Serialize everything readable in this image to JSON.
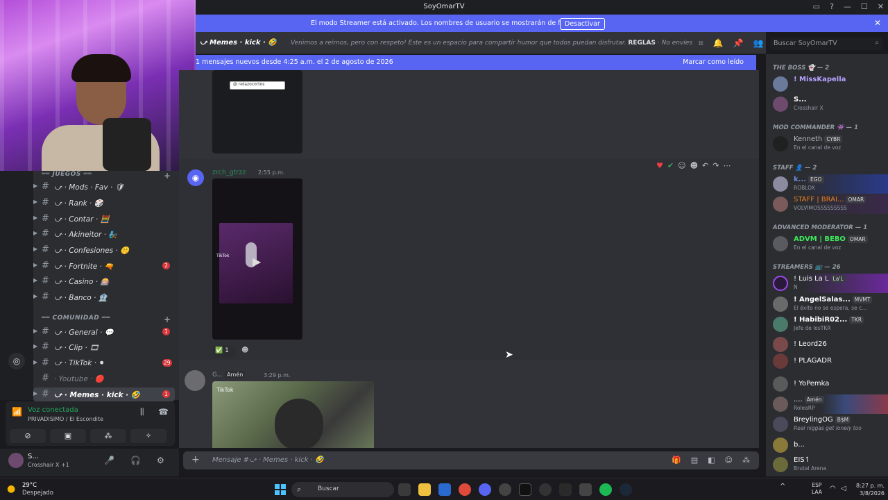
{
  "window": {
    "title": "SoyOmarTV"
  },
  "streamer_banner": {
    "text": "El modo Streamer está activado. Los nombres de usuario se mostrarán de forma parcial.",
    "button": "Desactivar"
  },
  "channel_header": {
    "name": "⤻ Memes · kick · 🤣",
    "topic": "Venimos a reírnos, pero con respeto! Este es un espacio para compartir humor que todos puedan disfrutar.",
    "topic_bold": "REGLAS",
    "topic_tail": "· No envíes memes que ...",
    "search_placeholder": "Buscar SoyOmarTV"
  },
  "new_messages_bar": {
    "text": "1 mensajes nuevos desde 4:25 a.m. el 2 de agosto de 2026",
    "mark_read": "Marcar como leído"
  },
  "categories": [
    {
      "label": "══ JUEGOS ══"
    },
    {
      "label": "══ COMUNIDAD ══"
    }
  ],
  "channels": [
    {
      "name": "⤻ · Mods · Fav · 🛡",
      "badge": ""
    },
    {
      "name": "⤻ · Rank · 🎲",
      "badge": ""
    },
    {
      "name": "⤻ · Contar · 🧮",
      "badge": ""
    },
    {
      "name": "⤻ · Akineitor · 🧞",
      "badge": ""
    },
    {
      "name": "⤻ · Confesiones · 🤫",
      "badge": ""
    },
    {
      "name": "⤻ · Fortnite · 🔫",
      "badge": "2"
    },
    {
      "name": "⤻ · Casino · 🎰",
      "badge": ""
    },
    {
      "name": "⤻ · Banco · 🏦",
      "badge": ""
    },
    {
      "name": "⤻ · General · 💬",
      "badge": "1"
    },
    {
      "name": "⤻ · Clip · 🎞",
      "badge": ""
    },
    {
      "name": "⤻ · TikTok · ⚫",
      "badge": "29"
    },
    {
      "name": "· Youtube · 🔴",
      "badge": ""
    },
    {
      "name": "⤻ · Memes · kick · 🤣",
      "badge": "1"
    }
  ],
  "voice": {
    "status": "Voz conectada",
    "channel": "PRIVADISIMO / El Escondite"
  },
  "user": {
    "name": "S...",
    "status": "Crosshair X +1"
  },
  "messages": [
    {
      "author": "zrch_gtrzz",
      "time": "2:55 p.m.",
      "reaction_count": "1"
    },
    {
      "author": "G...",
      "role": "Amén",
      "time": "3:29 p.m."
    }
  ],
  "media_labels": {
    "tiktok": "TikTok",
    "search_pill": "@ retazocortos"
  },
  "composer": {
    "placeholder": "Mensaje #⤻ · Memes · kick · 🤣"
  },
  "member_groups": [
    {
      "label": "THE BOSS 👻 — 2"
    },
    {
      "label": "MOD COMMANDER 👾 — 1"
    },
    {
      "label": "STAFF 👤 — 2"
    },
    {
      "label": "ADVANCED MODERATOR — 1"
    },
    {
      "label": "STREAMERS 📺 — 26"
    }
  ],
  "members": [
    {
      "name": "! MissKapella",
      "tag": "",
      "status": "",
      "color": "#b8a2ff"
    },
    {
      "name": "S...",
      "tag": "",
      "status": "Crosshair X",
      "color": "#ffffff"
    },
    {
      "name": "Kenneth",
      "tag": "CYBR",
      "status": "En el canal de voz",
      "color": "#b5bac1"
    },
    {
      "name": "k...",
      "tag": "EGO",
      "status": "ROBLOX",
      "color": "#7289da"
    },
    {
      "name": "STAFF | BRAI...",
      "tag": "OMAR",
      "status": "VOLVIMOSSSSSSSSS",
      "color": "#e67e22"
    },
    {
      "name": "ADVM | BEBO",
      "tag": "OMAR",
      "status": "En el canal de voz",
      "color": "#3ee85a"
    },
    {
      "name": "! Luis La L",
      "tag": "La'L",
      "status": "N",
      "color": "#ffffff"
    },
    {
      "name": "! AngelSalas...",
      "tag": "MVMT",
      "status": "El éxito no se espera, se c...",
      "color": "#ffffff"
    },
    {
      "name": "! HabibiR02...",
      "tag": "TKR",
      "status": "Jefe de losTKR",
      "color": "#ffffff"
    },
    {
      "name": "! Leord26",
      "tag": "",
      "status": "",
      "color": "#ffffff"
    },
    {
      "name": "! PLAGADR",
      "tag": "",
      "status": "",
      "color": "#ffffff"
    },
    {
      "name": "! YoPemka",
      "tag": "",
      "status": "",
      "color": "#ffffff"
    },
    {
      "name": "....",
      "tag": "Amén",
      "status": "RoleaRP",
      "color": "#ffffff"
    },
    {
      "name": "BreylingOG",
      "tag": "B$M",
      "status": "Real niggas get lonely too",
      "color": "#ffffff"
    },
    {
      "name": "b...",
      "tag": "",
      "status": "",
      "color": "#ffffff"
    },
    {
      "name": "EIS↿",
      "tag": "",
      "status": "Brutal Arena",
      "color": "#ffffff"
    }
  ],
  "taskbar": {
    "temp": "29°C",
    "weather": "Despejado",
    "search": "Buscar",
    "lang1": "ESP",
    "lang2": "LAA",
    "time": "8:27 p. m.",
    "date": "3/8/2026"
  },
  "colors": {
    "blurple": "#5865f2",
    "bg": "#313338",
    "sidebar": "#2b2d31",
    "danger": "#da373c",
    "green": "#23a55a"
  }
}
